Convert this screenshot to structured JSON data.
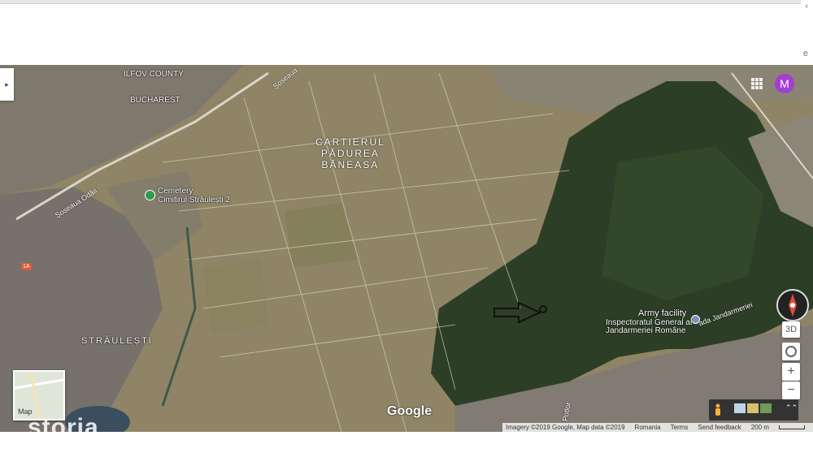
{
  "page": {
    "side_glyphs": [
      "‹",
      "e"
    ]
  },
  "map": {
    "labels": {
      "county": "ILFOV COUNTY",
      "city": "BUCHAREST",
      "district_line1": "CARTIERUL",
      "district_line2": "PĂDUREA",
      "district_line3": "BĂNEASA",
      "cemetery_title": "Cemetery",
      "cemetery_name": "Cimitirul Străulești 2",
      "straulesti": "STRĂULEȘTI",
      "army_title": "Army facility",
      "army_line1": "Inspectoratul General al",
      "army_line2": "Jandarmeriei Române",
      "road_odai": "Șoseaua Odăii",
      "road_top": "Șoseaua",
      "road_jandarmeriei": "ada Jandarmeriei",
      "road_small": "Potlor",
      "road_badge": "1A"
    },
    "controls": {
      "avatar_letter": "M",
      "tilt_label": "3D",
      "zoom_in": "+",
      "zoom_out": "−",
      "collapse_arrow": "▸",
      "expand_icon": "⌃⌃"
    },
    "minimap_label": "Map",
    "watermark": "storia",
    "google_logo": "Google",
    "footer": {
      "imagery": "Imagery ©2019 Google, Map data ©2019",
      "country": "Romania",
      "terms": "Terms",
      "feedback": "Send feedback",
      "scale": "200 m"
    },
    "colors": {
      "forest": "#2c3f26",
      "fields": "#8f8566",
      "urban": "#7d7670",
      "accent": "#a43ed1"
    }
  }
}
